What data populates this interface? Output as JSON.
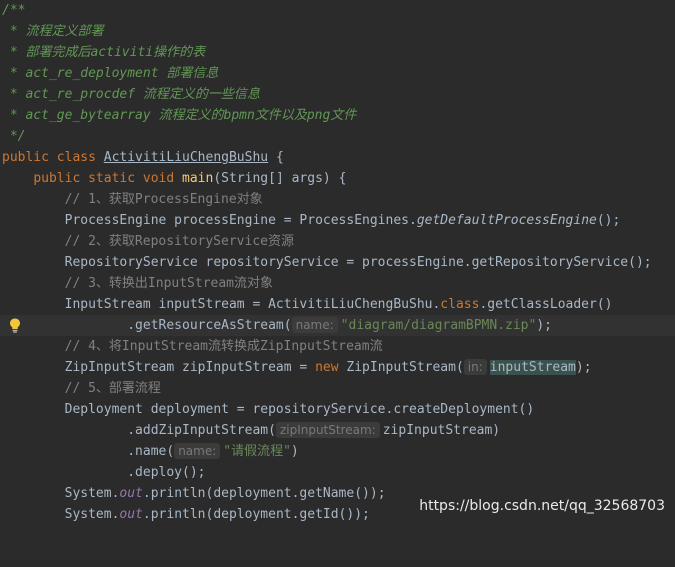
{
  "doc_comment": {
    "open": "/**",
    "line1": " * 流程定义部署",
    "line2": " * 部署完成后activiti操作的表",
    "line3": " * act_re_deployment 部署信息",
    "line4": " * act_re_procdef 流程定义的一些信息",
    "line5": " * act_ge_bytearray 流程定义的bpmn文件以及png文件",
    "close": " */"
  },
  "class_decl": {
    "kw": "public class ",
    "name": "ActivitiLiuChengBuShu",
    "rest": " {"
  },
  "method_decl": {
    "indent": "    ",
    "kw": "public static void ",
    "name": "main",
    "rest": "(String[] args) {"
  },
  "lines": {
    "c1": "        // 1、获取ProcessEngine对象",
    "l1": "        ProcessEngine processEngine = ProcessEngines.",
    "l1_call": "getDefaultProcessEngine",
    "l1_end": "();",
    "c2": "        // 2、获取RepositoryService资源",
    "l2": "        RepositoryService repositoryService = processEngine.getRepositoryService();",
    "c3": "        // 3、转换出InputStream流对象",
    "l3a": "        InputStream inputStream = ActivitiLiuChengBuShu.",
    "l3_kw": "class",
    "l3_end": ".getClassLoader()",
    "l3b": "                .getResourceAsStream(",
    "l3b_hint": "name:",
    "l3b_str": "\"diagram/diagramBPMN.zip\"",
    "l3b_end": ");",
    "c4": "        // 4、将InputStream流转换成ZipInputStream流",
    "l4a": "        ZipInputStream zipInputStream = ",
    "l4_kw": "new",
    "l4b": " ZipInputStream(",
    "l4_hint": "in:",
    "l4_arg": "inputStream",
    "l4_end": ");",
    "c5": "        // 5、部署流程",
    "l5": "        Deployment deployment = repositoryService.createDeployment()",
    "l6": "                .addZipInputStream(",
    "l6_hint": "zipInputStream:",
    "l6_arg": "zipInputStream)",
    "l7": "                .name(",
    "l7_hint": "name:",
    "l7_str": "\"请假流程\"",
    "l7_end": ")",
    "l8": "                .deploy();",
    "l9a": "        System.",
    "l9_out": "out",
    "l9b": ".println(deployment.getName());",
    "l10a": "        System.",
    "l10_out": "out",
    "l10b": ".println(deployment.getId());"
  },
  "watermark": "https://blog.csdn.net/qq_32568703",
  "icons": {
    "intention": "lightbulb-icon"
  },
  "colors": {
    "background": "#2b2b2b",
    "doc_comment": "#629755",
    "comment": "#808080",
    "keyword": "#cc7832",
    "string": "#6a8759",
    "method": "#ffc66d",
    "static_field": "#9876aa",
    "text": "#a9b7c6"
  }
}
